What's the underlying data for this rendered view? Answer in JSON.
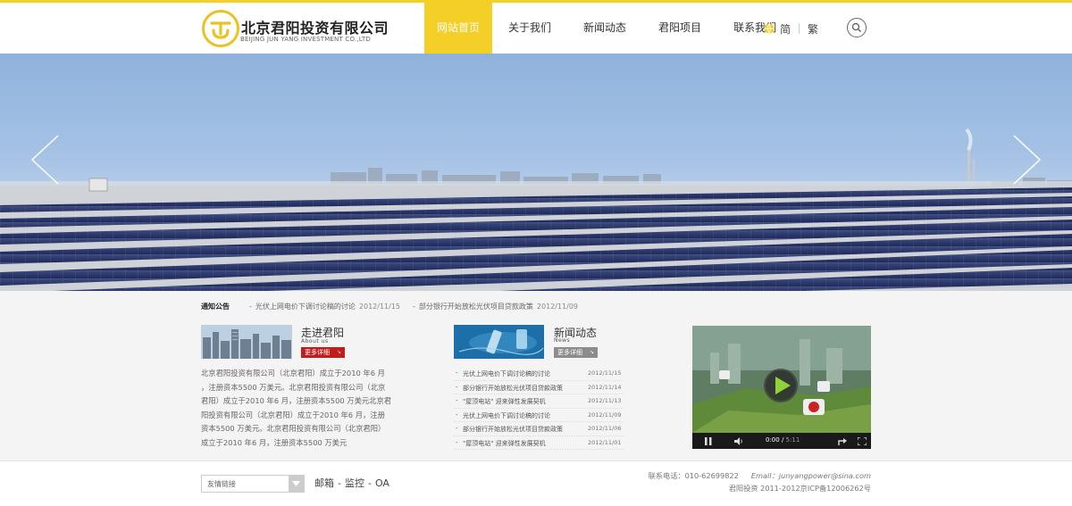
{
  "brand": {
    "name_cn": "北京君阳投资有限公司",
    "name_en": "BEIJING JUN YANG INVESTMENT CO.,LTD",
    "accent_color": "#f3cf27"
  },
  "nav": {
    "items": [
      {
        "label": "网站首页",
        "active": true
      },
      {
        "label": "关于我们",
        "active": false
      },
      {
        "label": "新闻动态",
        "active": false
      },
      {
        "label": "君阳项目",
        "active": false
      },
      {
        "label": "联系我们",
        "active": false
      }
    ]
  },
  "language": {
    "simplified": "简",
    "traditional": "繁"
  },
  "notice": {
    "title": "通知公告",
    "items": [
      {
        "text": "光伏上网电价下调讨论稿的讨论",
        "date": "2012/11/15"
      },
      {
        "text": "部分银行开始放松光伏项目贷款政策",
        "date": "2012/11/09"
      }
    ]
  },
  "about": {
    "title": "走进君阳",
    "subtitle": "About us",
    "more_label": "更多详细",
    "lines": [
      "北京君阳投资有限公司（北京君阳）成立于2010 年6 月",
      "，注册资本5500 万美元。北京君阳投资有限公司（北京",
      "君阳）成立于2010 年6 月，注册资本5500 万美元北京君",
      "阳投资有限公司（北京君阳）成立于2010 年6 月，注册",
      "资本5500 万美元。北京君阳投资有限公司（北京君阳）",
      "成立于2010 年6 月，注册资本5500 万美元"
    ]
  },
  "news": {
    "title": "新闻动态",
    "subtitle": "News",
    "more_label": "更多详细",
    "items": [
      {
        "title": "光伏上网电价下调讨论稿的讨论",
        "date": "2012/11/15"
      },
      {
        "title": "部分银行开始放松光伏项目贷款政策",
        "date": "2012/11/14"
      },
      {
        "title": "\"屋顶电站\" 迎来弹性发展契机",
        "date": "2012/11/13"
      },
      {
        "title": "光伏上网电价下调讨论稿的讨论",
        "date": "2012/11/09"
      },
      {
        "title": "部分银行开始放松光伏项目贷款政策",
        "date": "2012/11/06"
      },
      {
        "title": "\"屋顶电站\" 迎来弹性发展契机",
        "date": "2012/11/01"
      }
    ]
  },
  "video": {
    "current_time": "0:00",
    "duration": "5:11",
    "progress": 0
  },
  "footer": {
    "links_select": "友情链接",
    "links": [
      "邮箱",
      "监控",
      "OA"
    ],
    "link_separator": "-",
    "phone": "联系电话：010-62699822",
    "email": "Email：junyangpower@sina.com",
    "copyright": "君阳投资 2011-2012京ICP备12006262号"
  }
}
